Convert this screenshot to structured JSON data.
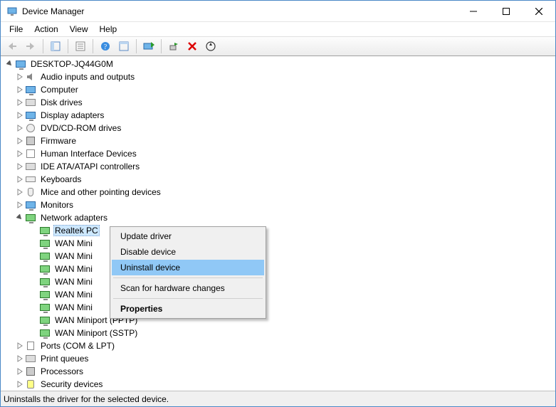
{
  "window": {
    "title": "Device Manager"
  },
  "menu": {
    "file": "File",
    "action": "Action",
    "view": "View",
    "help": "Help"
  },
  "tree": {
    "root": "DESKTOP-JQ44G0M",
    "categories": [
      {
        "label": "Audio inputs and outputs"
      },
      {
        "label": "Computer"
      },
      {
        "label": "Disk drives"
      },
      {
        "label": "Display adapters"
      },
      {
        "label": "DVD/CD-ROM drives"
      },
      {
        "label": "Firmware"
      },
      {
        "label": "Human Interface Devices"
      },
      {
        "label": "IDE ATA/ATAPI controllers"
      },
      {
        "label": "Keyboards"
      },
      {
        "label": "Mice and other pointing devices"
      },
      {
        "label": "Monitors"
      },
      {
        "label": "Network adapters"
      },
      {
        "label": "Ports (COM & LPT)"
      },
      {
        "label": "Print queues"
      },
      {
        "label": "Processors"
      },
      {
        "label": "Security devices"
      }
    ],
    "network_children": [
      "Realtek PC",
      "WAN Mini",
      "WAN Mini",
      "WAN Mini",
      "WAN Mini",
      "WAN Mini",
      "WAN Mini",
      "WAN Miniport (PPTP)",
      "WAN Miniport (SSTP)"
    ]
  },
  "context_menu": {
    "update": "Update driver",
    "disable": "Disable device",
    "uninstall": "Uninstall device",
    "scan": "Scan for hardware changes",
    "properties": "Properties"
  },
  "statusbar": {
    "text": "Uninstalls the driver for the selected device."
  }
}
